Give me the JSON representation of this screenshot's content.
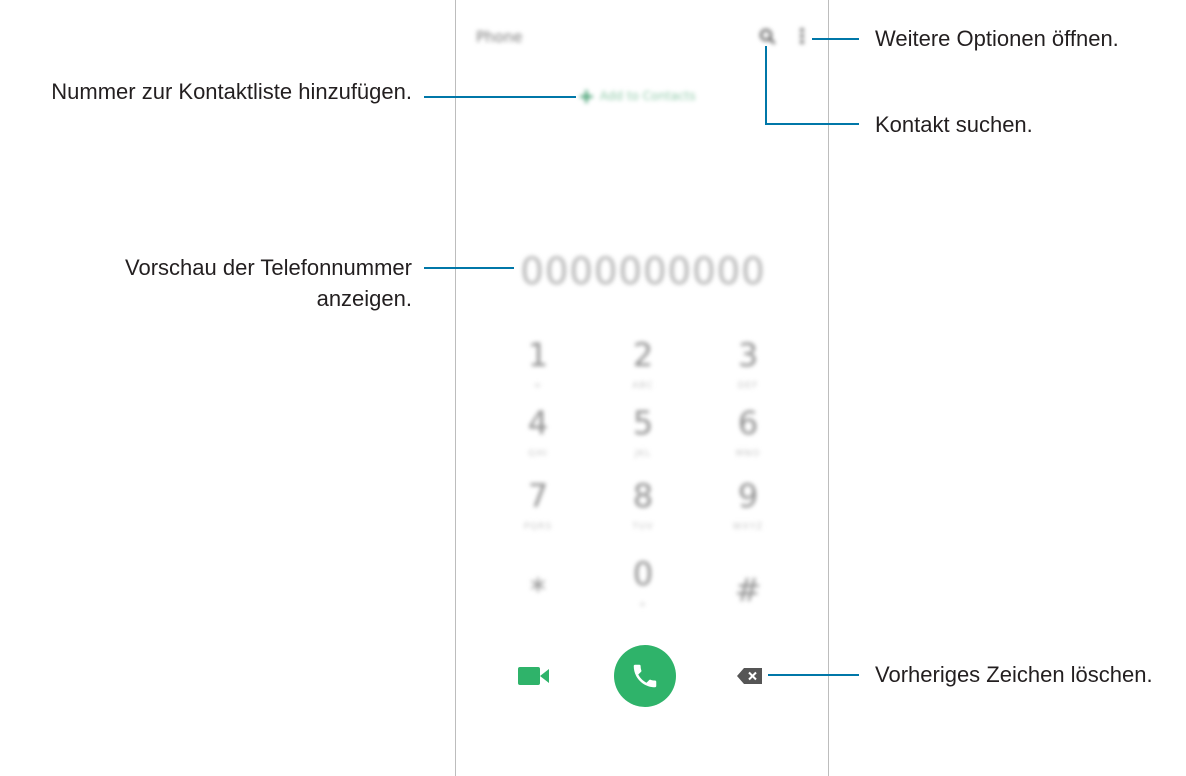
{
  "app": {
    "title": "Phone",
    "add_contact_label": "Add to Contacts",
    "number_preview": "0000000000",
    "accent_color": "#2fb36a"
  },
  "keypad": [
    {
      "digit": "1",
      "letters": "∞"
    },
    {
      "digit": "2",
      "letters": "ABC"
    },
    {
      "digit": "3",
      "letters": "DEF"
    },
    {
      "digit": "4",
      "letters": "GHI"
    },
    {
      "digit": "5",
      "letters": "JKL"
    },
    {
      "digit": "6",
      "letters": "MNO"
    },
    {
      "digit": "7",
      "letters": "PQRS"
    },
    {
      "digit": "8",
      "letters": "TUV"
    },
    {
      "digit": "9",
      "letters": "WXYZ"
    },
    {
      "digit": "*",
      "letters": ""
    },
    {
      "digit": "0",
      "letters": "+"
    },
    {
      "digit": "#",
      "letters": ""
    }
  ],
  "icons": {
    "search": "search-icon",
    "more": "more-options-icon",
    "video_call": "video-call-icon",
    "call": "phone-call-icon",
    "backspace": "backspace-icon"
  },
  "callouts": {
    "add_contact": "Nummer zur Kontaktliste hinzufügen.",
    "number_preview_line1": "Vorschau der Telefonnummer",
    "number_preview_line2": "anzeigen.",
    "more_options": "Weitere Optionen öffnen.",
    "search": "Kontakt suchen.",
    "backspace": "Vorheriges Zeichen löschen."
  },
  "callout_color": "#0077a8"
}
